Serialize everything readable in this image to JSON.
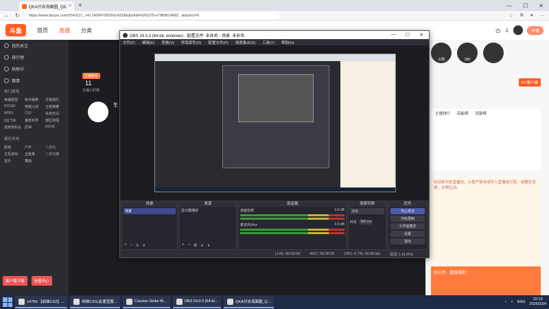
{
  "browser": {
    "tab_title": "QKA付去海面圈_QKA付去海面园",
    "url": "https://www.douyu.com/5543117_r=0.1400479505514228&dyshid=d2fc075-e79f0fb14b82...&dyshci=6"
  },
  "site": {
    "logo": "斗鱼",
    "nav": [
      "首页",
      "直播",
      "分类"
    ],
    "open_live_button": "开播"
  },
  "left_sidebar": {
    "items": [
      "我的关注",
      "排行榜",
      "热映中",
      "赛事"
    ],
    "section1": "热门游戏",
    "games": [
      "英雄联盟",
      "和平精英",
      "无畏契约",
      "DOTA2",
      "穿越火线",
      "王者荣耀",
      "APEX",
      "CS2",
      "永劫无间",
      "QQ飞车",
      "魔兽世界",
      "暗区突围",
      "逃离塔科夫",
      "原神",
      "DOTA"
    ],
    "section2": "娱乐天地",
    "ent": [
      "颜值",
      "户外",
      "二次元",
      "主机游戏",
      "正能量",
      "二次元游",
      "音乐",
      "舞蹈"
    ],
    "buttons": [
      "客户端下载",
      "充值中心"
    ]
  },
  "room": {
    "badge": "主播排名",
    "rank": "11",
    "rank_label": "主播小时榜",
    "streamer": "生"
  },
  "right_panel": {
    "gifts": [
      "火箭",
      "300"
    ],
    "pc_button": "PC客户端",
    "tabs": [
      "主播排行",
      "高能榜",
      "贡献榜"
    ],
    "chat_text": "欢迎来到本直播间，斗鱼严禁未成年人直播或打赏。请理性消费，文明互动。",
    "promo": "好心伴 · 超级福利"
  },
  "obs": {
    "title": "OBS 24.0.3 (64-bit, windows) - 配置文件: 未命名 - 场景: 未命名",
    "menu": [
      "文件(F)",
      "编辑(E)",
      "查看(V)",
      "停靠部件(D)",
      "配置文件(P)",
      "场景集合(S)",
      "工具(T)",
      "帮助(H)"
    ],
    "docks": {
      "scenes": {
        "title": "场景",
        "items": [
          "场景"
        ]
      },
      "sources": {
        "title": "来源",
        "items": [
          "显示器捕获"
        ]
      },
      "mixer": {
        "title": "混音器",
        "tracks": [
          "桌面音频",
          "麦克风/Aux"
        ],
        "db": [
          "0.0 dB",
          "0.0 dB"
        ]
      },
      "transitions": {
        "title": "场景转换",
        "type": "淡出",
        "duration_label": "时长",
        "duration": "300 ms"
      },
      "controls": {
        "title": "控件",
        "buttons": [
          "停止推流",
          "开始录制",
          "工作室模式",
          "设置",
          "退出"
        ]
      }
    },
    "status": {
      "live": "LIVE: 00:00:00",
      "rec": "REC: 00:00:00",
      "cpu": "CPU: 0.7%, 60.00 fps",
      "dropped": "延迟 1 (0.0%)"
    }
  },
  "taskbar": {
    "items": [
      "14759-【前锋CS2】...",
      "网络CS公会便宜服...",
      "Counter-Strike Bl...",
      "OBS 24.0.3 (64-bi...",
      "QKA付去海面圈_Q..."
    ],
    "lang": "ENG",
    "time": "22:13",
    "date": "2025/2/24"
  },
  "colors": {
    "accent": "#ff5d23",
    "obs_bg": "#2d2e36",
    "taskbar": "#1f2a44"
  }
}
